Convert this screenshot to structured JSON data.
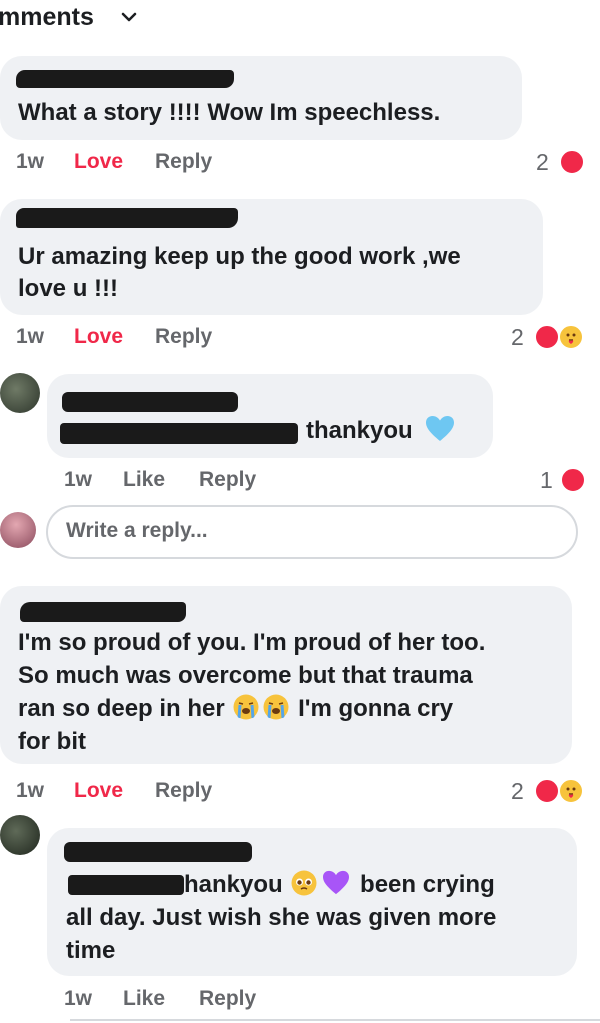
{
  "header": {
    "title": "mments"
  },
  "comments": [
    {
      "text": "What a story !!!! Wow Im speechless.",
      "time": "1w",
      "reaction_label": "Love",
      "reply_label": "Reply",
      "reaction_count": "2"
    },
    {
      "text_line1": "Ur amazing keep up the good work ,we",
      "text_line2": "love u !!!",
      "time": "1w",
      "reaction_label": "Love",
      "reply_label": "Reply",
      "reaction_count": "2"
    },
    {
      "text": "thankyou",
      "time": "1w",
      "reaction_label": "Like",
      "reply_label": "Reply",
      "reaction_count": "1"
    },
    {
      "text_line1": "I'm so proud of you. I'm proud of her too.",
      "text_line2": "So much was overcome but that trauma",
      "text_line3a": "ran so deep in her",
      "text_line3b": "I'm gonna cry",
      "text_line4": "for bit",
      "time": "1w",
      "reaction_label": "Love",
      "reply_label": "Reply",
      "reaction_count": "2"
    },
    {
      "text_line1a": "hankyou",
      "text_line1b": "been crying",
      "text_line2": "all day. Just wish she was given more",
      "text_line3": "time",
      "time": "1w",
      "reaction_label": "Like",
      "reply_label": "Reply"
    }
  ],
  "reply_box": {
    "placeholder": "Write a reply..."
  },
  "colors": {
    "love": "#f02849",
    "meta": "#65676b",
    "bubble": "#eff1f4",
    "heart": "#f02849"
  },
  "icons": [
    "chevron-down-icon",
    "heart-reaction-icon",
    "care-reaction-icon",
    "loudly-crying-emoji-icon",
    "pleading-face-emoji-icon",
    "purple-heart-emoji-icon",
    "light-blue-heart-emoji-icon"
  ]
}
